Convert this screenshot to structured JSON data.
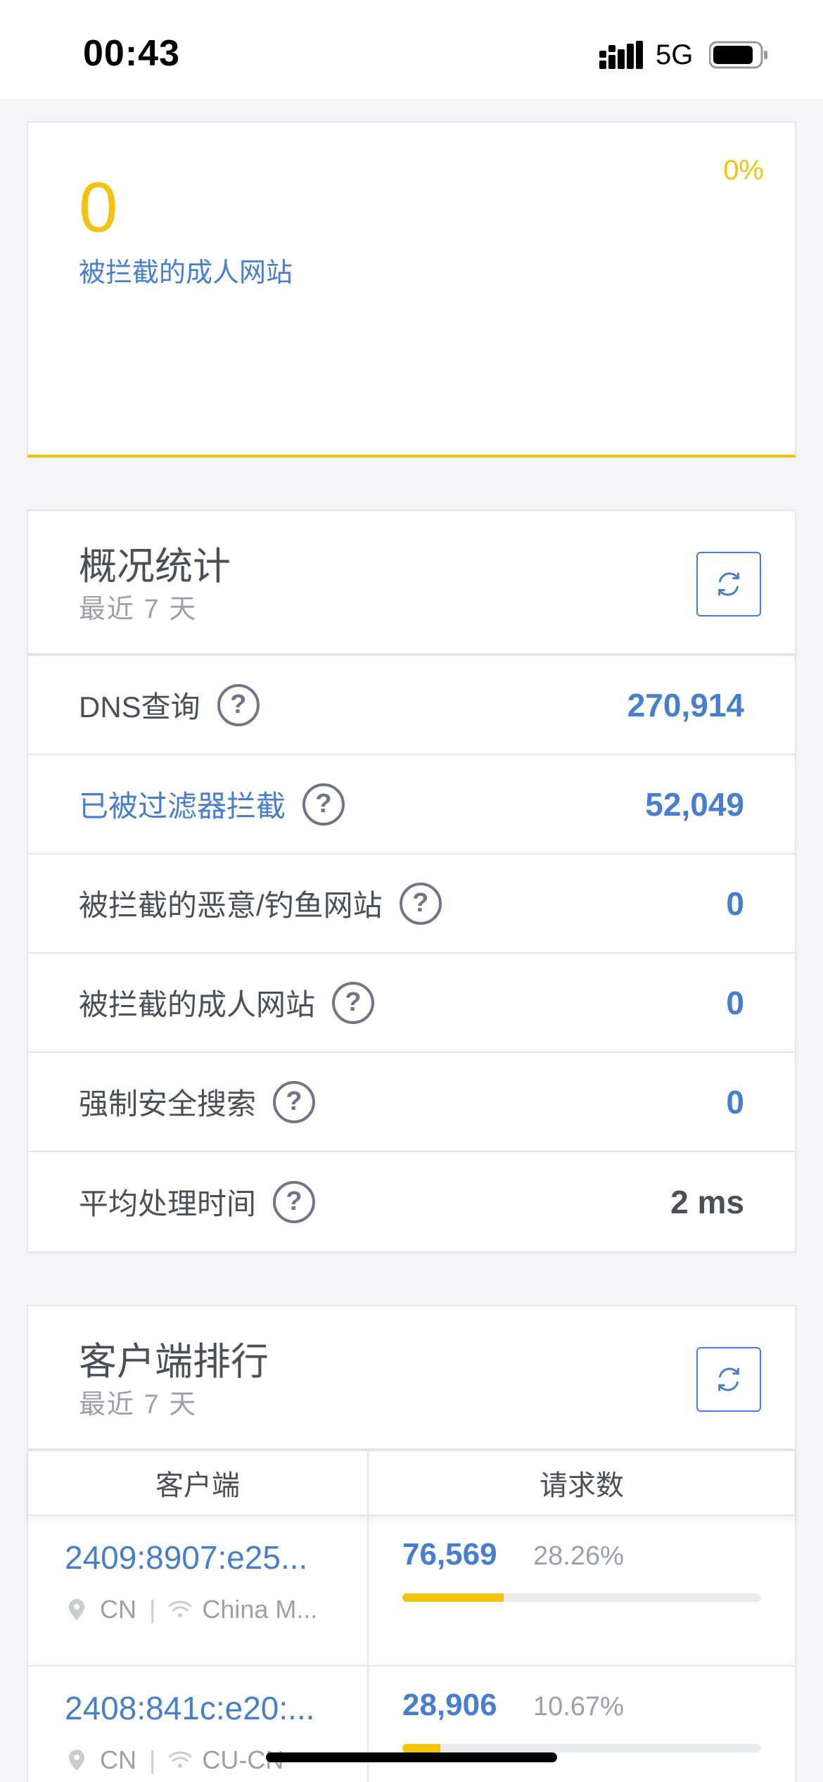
{
  "status_bar": {
    "time": "00:43",
    "network": "5G"
  },
  "highlight_card": {
    "value": "0",
    "label": "被拦截的成人网站",
    "percent": "0%",
    "accent_color": "#f1c40f"
  },
  "overview": {
    "title": "概况统计",
    "subtitle": "最近 7 天",
    "refresh_icon": "refresh-icon",
    "rows": [
      {
        "label": "DNS查询",
        "value": "270,914"
      },
      {
        "label": "已被过滤器拦截",
        "value": "52,049"
      },
      {
        "label": "被拦截的恶意/钓鱼网站",
        "value": "0"
      },
      {
        "label": "被拦截的成人网站",
        "value": "0"
      },
      {
        "label": "强制安全搜索",
        "value": "0"
      },
      {
        "label": "平均处理时间",
        "value": "2 ms"
      }
    ]
  },
  "top_clients": {
    "title": "客户端排行",
    "subtitle": "最近 7 天",
    "columns": [
      "客户端",
      "请求数"
    ],
    "rows": [
      {
        "client": "2409:8907:e25...",
        "country": "CN",
        "network": "China M...",
        "count": "76,569",
        "percent": "28.26%",
        "share": 0.2826
      },
      {
        "client": "2408:841c:e20:...",
        "country": "CN",
        "network": "CU-CN",
        "count": "28,906",
        "percent": "10.67%",
        "share": 0.1067
      }
    ]
  },
  "colors": {
    "link": "#467fcf",
    "text": "#495057",
    "muted": "#9aa0ac",
    "bar": "#f1c40f"
  }
}
